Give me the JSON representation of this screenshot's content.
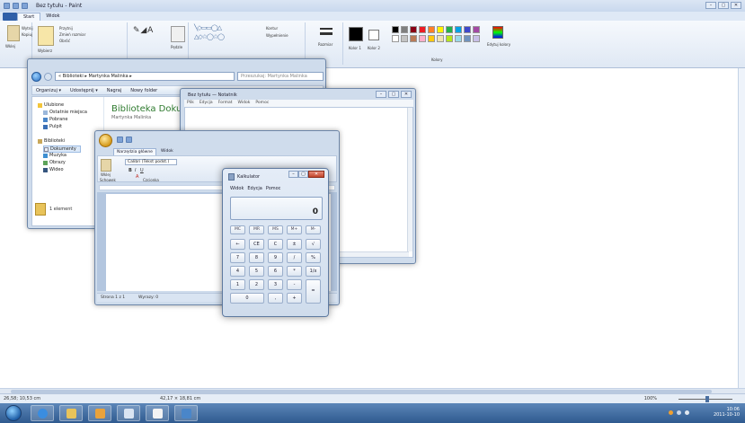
{
  "paint": {
    "title": "Bez tytułu - Paint",
    "window_controls": [
      "–",
      "▢",
      "✕"
    ],
    "tabs": {
      "menu": "",
      "start": "Start",
      "view": "Widok"
    },
    "ribbon": {
      "paste": "Wklej",
      "cut": "Wytnij",
      "copy": "Kopiuj",
      "select": "Wybierz",
      "crop": "Przytnij",
      "resize": "Zmień rozmiar",
      "rotate": "Obróć",
      "brushes": "Pędzle",
      "outline": "Kontur",
      "fill": "Wypełnienie",
      "size": "Rozmiar",
      "color1": "Kolor 1",
      "color2": "Kolor 2",
      "edit_colors": "Edytuj kolory",
      "colors_group": "Kolory"
    },
    "palette": [
      "#000000",
      "#7f7f7f",
      "#880015",
      "#ed1c24",
      "#ff7f27",
      "#fff200",
      "#22b14c",
      "#00a2e8",
      "#3f48cc",
      "#a349a4",
      "#ffffff",
      "#c3c3c3",
      "#b97a57",
      "#ffaec9",
      "#ffc90e",
      "#efe4b0",
      "#b5e61d",
      "#99d9ea",
      "#7092be",
      "#c8bfe7"
    ],
    "status": {
      "cursor_pos": "26,58; 10,53 cm",
      "selection_size": "42,17 × 18,81 cm",
      "zoom": "100%"
    }
  },
  "explorer": {
    "address": "« Biblioteki ▸ Martynka Malinka ▸",
    "search_placeholder": "Przeszukaj: Martynka Malinka",
    "toolbar": {
      "organize": "Organizuj ▾",
      "share": "Udostępnij ▾",
      "burn": "Nagraj",
      "new_folder": "Nowy folder"
    },
    "nav": {
      "favorites": "Ulubione",
      "recent": "Ostatnie miejsca",
      "downloads": "Pobrane",
      "desktop": "Pulpit",
      "libraries": "Biblioteki",
      "documents": "Dokumenty",
      "music": "Muzyka",
      "pictures": "Obrazy",
      "videos": "Wideo"
    },
    "library_title": "Biblioteka Dokumenty",
    "library_sub": "Martynka Malinka",
    "items_count": "1 element"
  },
  "wordpad": {
    "tabs": {
      "home": "Narzędzia główne",
      "view": "Widok"
    },
    "ribbon": {
      "font": "Calibri (Tekst podst.)",
      "paste": "Wklej",
      "clipboard": "Schowek",
      "font_group": "Czcionka"
    },
    "status": {
      "page": "Strona 1 z 1",
      "words": "Wyrazy: 0"
    }
  },
  "notepad": {
    "title": "Bez tytułu — Notatnik",
    "menu": [
      "Plik",
      "Edycja",
      "Format",
      "Widok",
      "Pomoc"
    ]
  },
  "calculator": {
    "title": "Kalkulator",
    "menu": [
      "Widok",
      "Edycja",
      "Pomoc"
    ],
    "display": "0",
    "rows": [
      [
        "MC",
        "MR",
        "MS",
        "M+",
        "M-"
      ],
      [
        "←",
        "CE",
        "C",
        "±",
        "√"
      ],
      [
        "7",
        "8",
        "9",
        "/",
        "%"
      ],
      [
        "4",
        "5",
        "6",
        "*",
        "1/x"
      ],
      [
        "1",
        "2",
        "3",
        "-",
        "="
      ],
      [
        "0",
        ",",
        "+"
      ]
    ]
  },
  "taskbar": {
    "time": "10:06",
    "date": "2011-10-10"
  }
}
